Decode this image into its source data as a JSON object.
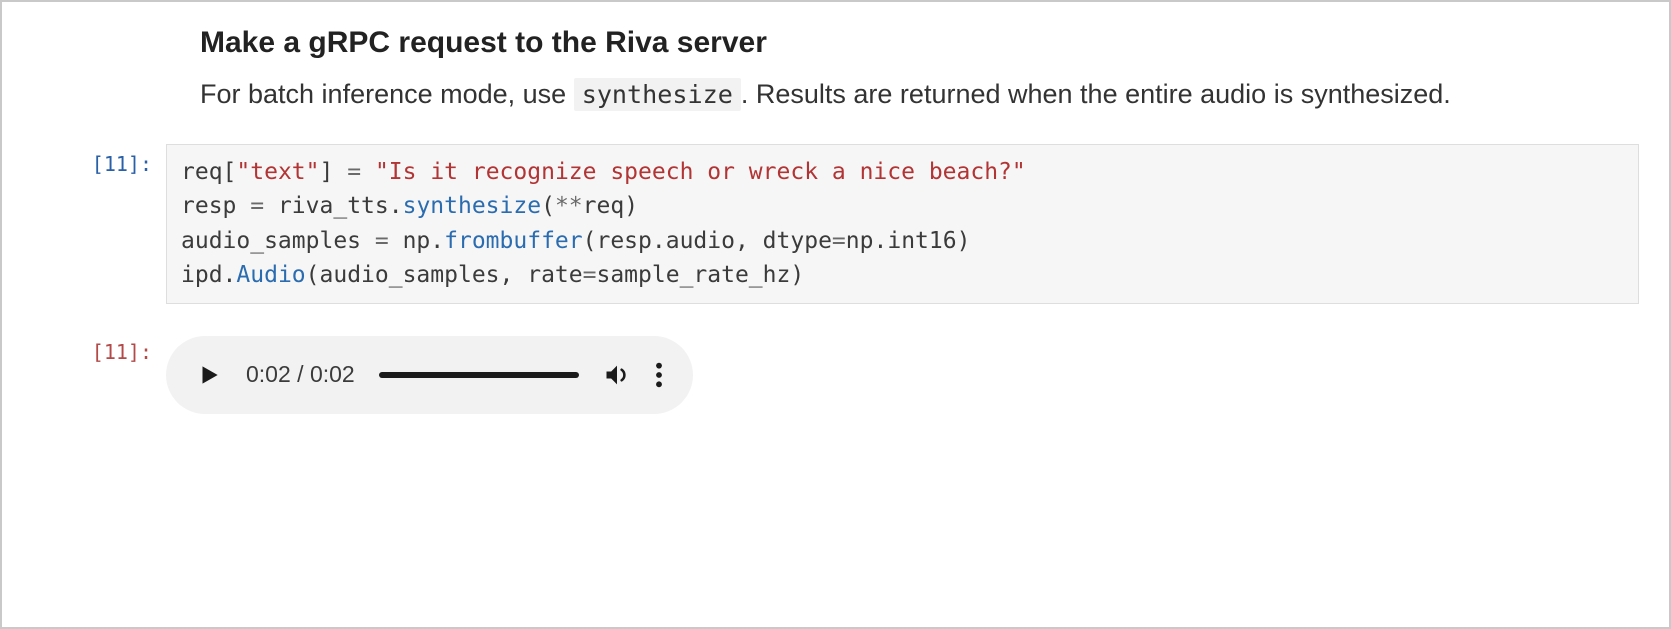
{
  "markdown": {
    "heading": "Make a gRPC request to the Riva server",
    "paragraph_before": "For batch inference mode, use ",
    "inline_code": "synthesize",
    "paragraph_after": ". Results are returned when the entire audio is synthesized."
  },
  "input_cell": {
    "prompt": "[11]:",
    "code_tokens": [
      [
        {
          "t": "req",
          "c": "n"
        },
        {
          "t": "[",
          "c": "p"
        },
        {
          "t": "\"text\"",
          "c": "s"
        },
        {
          "t": "]",
          "c": "p"
        },
        {
          "t": " ",
          "c": "p"
        },
        {
          "t": "=",
          "c": "o"
        },
        {
          "t": " ",
          "c": "p"
        },
        {
          "t": "\"Is it recognize speech or wreck a nice beach?\"",
          "c": "s"
        }
      ],
      [
        {
          "t": "resp ",
          "c": "n"
        },
        {
          "t": "=",
          "c": "o"
        },
        {
          "t": " riva_tts",
          "c": "n"
        },
        {
          "t": ".",
          "c": "p"
        },
        {
          "t": "synthesize",
          "c": "f"
        },
        {
          "t": "(",
          "c": "p"
        },
        {
          "t": "**",
          "c": "o"
        },
        {
          "t": "req",
          "c": "n"
        },
        {
          "t": ")",
          "c": "p"
        }
      ],
      [
        {
          "t": "audio_samples ",
          "c": "n"
        },
        {
          "t": "=",
          "c": "o"
        },
        {
          "t": " np",
          "c": "n"
        },
        {
          "t": ".",
          "c": "p"
        },
        {
          "t": "frombuffer",
          "c": "f"
        },
        {
          "t": "(resp",
          "c": "n"
        },
        {
          "t": ".",
          "c": "p"
        },
        {
          "t": "audio",
          "c": "n"
        },
        {
          "t": ", dtype",
          "c": "n"
        },
        {
          "t": "=",
          "c": "o"
        },
        {
          "t": "np",
          "c": "n"
        },
        {
          "t": ".",
          "c": "p"
        },
        {
          "t": "int16",
          "c": "n"
        },
        {
          "t": ")",
          "c": "p"
        }
      ],
      [
        {
          "t": "ipd",
          "c": "n"
        },
        {
          "t": ".",
          "c": "p"
        },
        {
          "t": "Audio",
          "c": "f"
        },
        {
          "t": "(audio_samples",
          "c": "n"
        },
        {
          "t": ", rate",
          "c": "n"
        },
        {
          "t": "=",
          "c": "o"
        },
        {
          "t": "sample_rate_hz",
          "c": "n"
        },
        {
          "t": ")",
          "c": "p"
        }
      ]
    ]
  },
  "output_cell": {
    "prompt": "[11]:",
    "audio": {
      "current_time": "0:02",
      "duration": "0:02"
    }
  }
}
